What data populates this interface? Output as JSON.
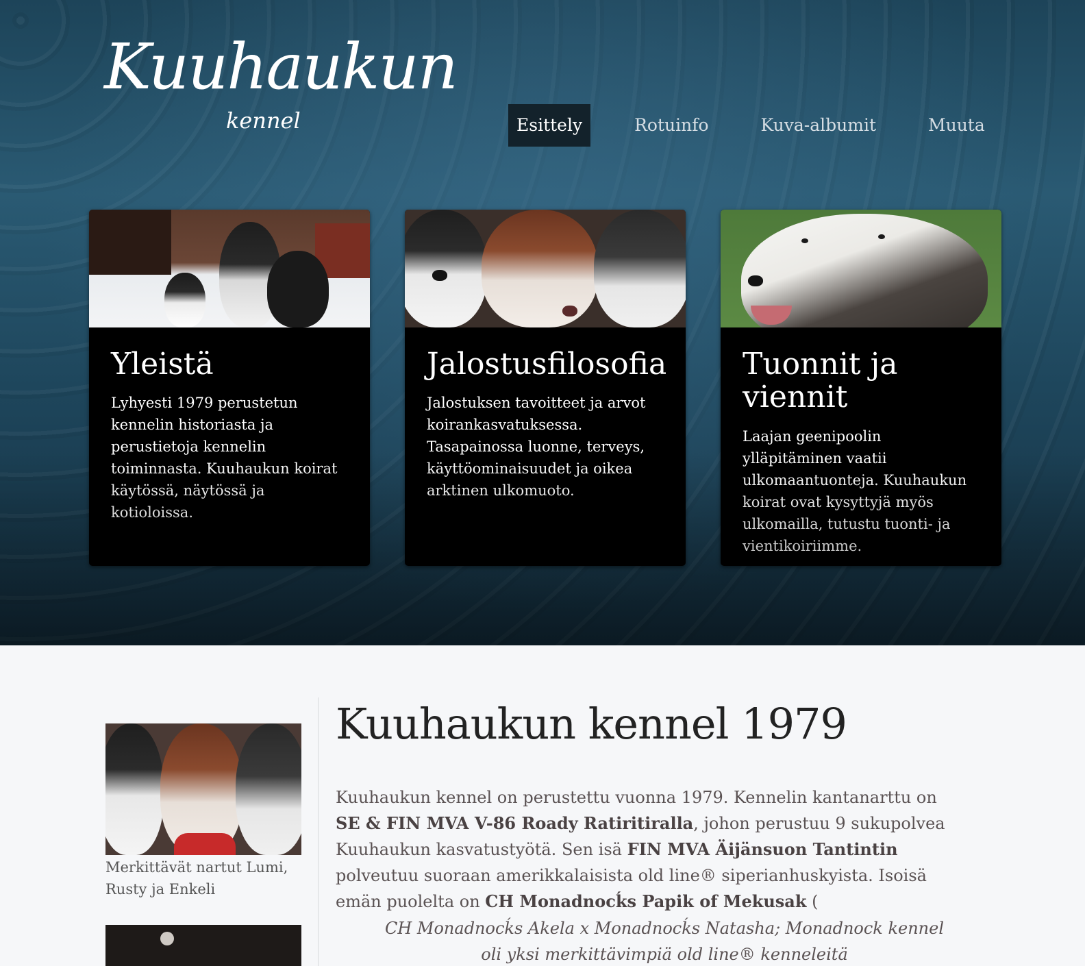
{
  "logo": {
    "main": "Kuuhaukun",
    "sub": "kennel"
  },
  "nav": {
    "items": [
      "Esittely",
      "Rotuinfo",
      "Kuva-albumit",
      "Muuta"
    ],
    "active": "Esittely"
  },
  "cards": [
    {
      "title": "Yleistä",
      "text": "Lyhyesti 1979 perustetun kennelin historiasta ja perustietoja kennelin toiminnasta. Kuuhaukun koirat käytössä, näytössä ja kotioloissa."
    },
    {
      "title": "Jalostusfilosofia",
      "text": "Jalostuksen tavoitteet ja arvot koirankasvatuksessa. Tasapainossa luonne, terveys, käyttöominaisuudet ja oikea arktinen ulkomuoto."
    },
    {
      "title": "Tuonnit ja viennit",
      "text": "Laajan geenipoolin ylläpitäminen vaatii ulkomaantuonteja. Kuuhaukun koirat ovat kysyttyjä myös ulkomailla, tutustu tuonti- ja vientikoiriimme."
    }
  ],
  "sidebar": {
    "caption": "Merkittävät nartut Lumi, Rusty ja Enkeli"
  },
  "main": {
    "title": "Kuuhaukun kennel 1979",
    "p1_a": "Kuuhaukun kennel on perustettu vuonna 1979. Kennelin kantanarttu on ",
    "p1_b": "SE & FIN MVA V-86 Roady Ratiritiralla",
    "p1_c": ", johon perustuu 9 sukupolvea Kuuhaukun kasvatustyötä. Sen isä ",
    "p1_d": "FIN MVA Äijänsuon Tantintin",
    "p1_e": " polveutuu suoraan amerikkalaisista old line® siperianhuskyista. Isoisä emän puolelta on ",
    "p1_f": "CH Monadnocḱs Papik of Mekusak",
    "p1_g": " (",
    "quote": "CH Monadnocḱs Akela x Monadnocḱs Natasha; Monadnock kennel oli yksi merkittävimpiä old line® kenneleitä"
  },
  "colors": {
    "hero_bg": "#1e465c",
    "card_bg": "#000000",
    "content_bg": "#f6f7f9",
    "nav_active_bg": "#13222b"
  }
}
